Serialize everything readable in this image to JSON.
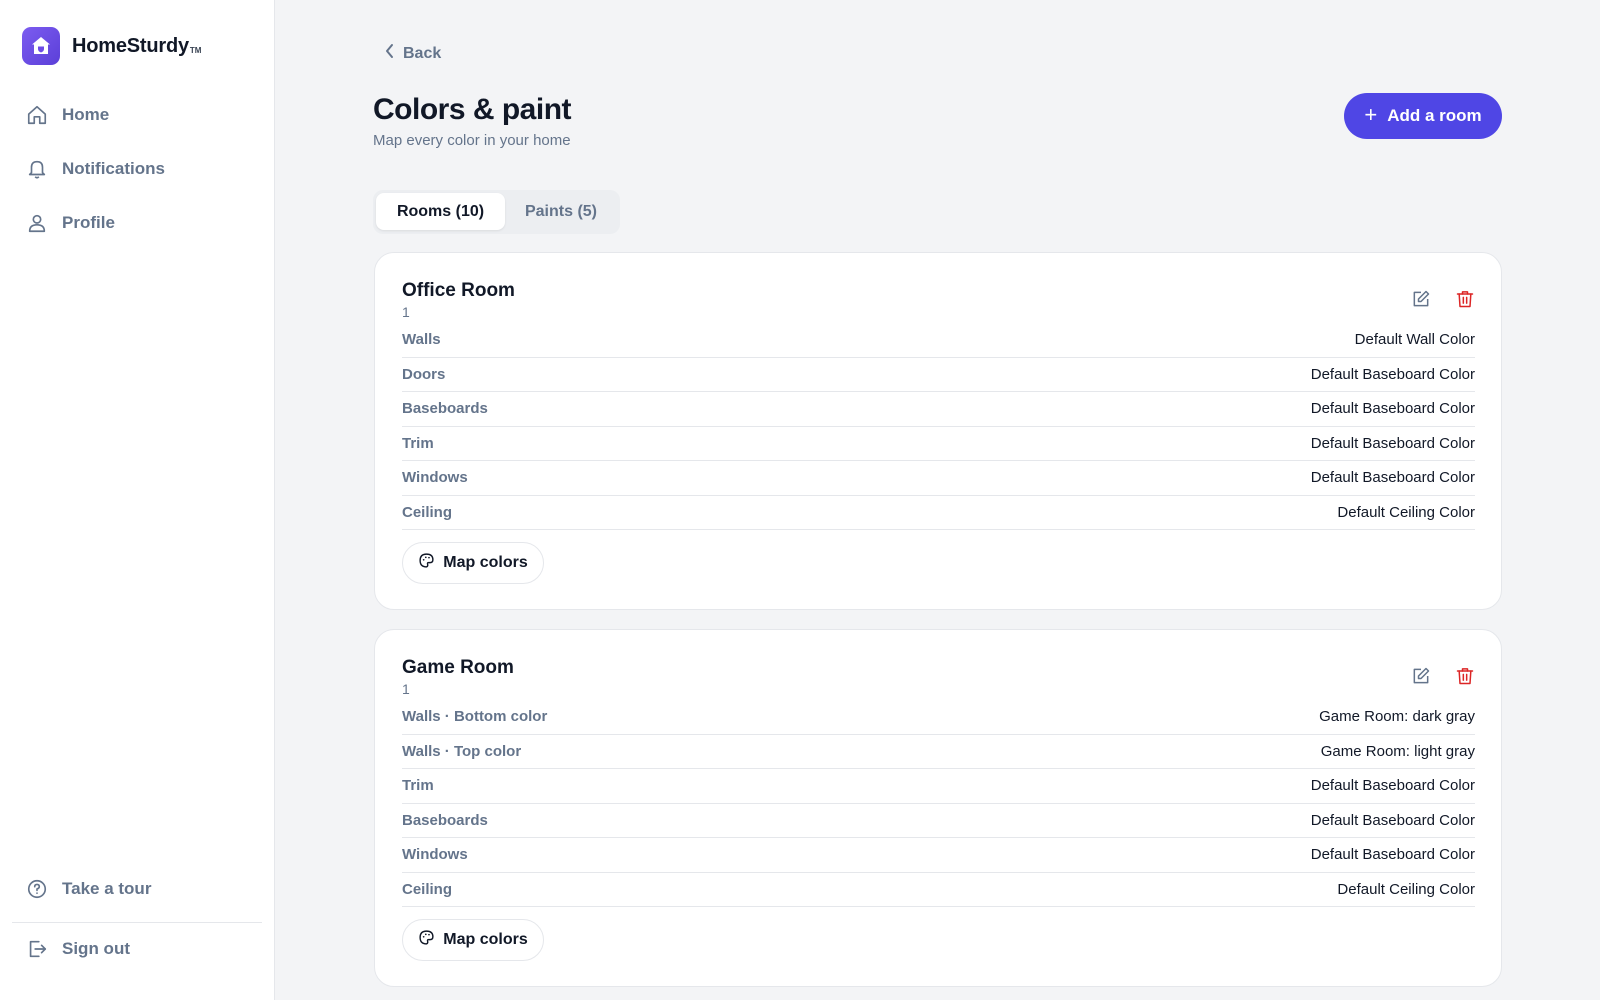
{
  "app": {
    "name": "HomeSturdy",
    "tm": "TM"
  },
  "sidebar": {
    "nav": [
      {
        "label": "Home",
        "icon": "home-icon"
      },
      {
        "label": "Notifications",
        "icon": "bell-icon"
      },
      {
        "label": "Profile",
        "icon": "user-icon"
      }
    ],
    "bottom": [
      {
        "label": "Take a tour",
        "icon": "help-circle-icon"
      },
      {
        "label": "Sign out",
        "icon": "sign-out-icon"
      }
    ]
  },
  "header": {
    "back_label": "Back",
    "title": "Colors & paint",
    "subtitle": "Map every color in your home",
    "add_button_label": "Add a room"
  },
  "tabs": [
    {
      "label": "Rooms (10)",
      "active": true
    },
    {
      "label": "Paints (5)",
      "active": false
    }
  ],
  "rooms": [
    {
      "name": "Office Room",
      "sub": "1",
      "rows": [
        {
          "label": "Walls",
          "value": "Default Wall Color"
        },
        {
          "label": "Doors",
          "value": "Default Baseboard Color"
        },
        {
          "label": "Baseboards",
          "value": "Default Baseboard Color"
        },
        {
          "label": "Trim",
          "value": "Default Baseboard Color"
        },
        {
          "label": "Windows",
          "value": "Default Baseboard Color"
        },
        {
          "label": "Ceiling",
          "value": "Default Ceiling Color"
        }
      ],
      "map_button_label": "Map colors"
    },
    {
      "name": "Game Room",
      "sub": "1",
      "rows": [
        {
          "label": "Walls · Bottom color",
          "value": "Game Room: dark gray"
        },
        {
          "label": "Walls · Top color",
          "value": "Game Room: light gray"
        },
        {
          "label": "Trim",
          "value": "Default Baseboard Color"
        },
        {
          "label": "Baseboards",
          "value": "Default Baseboard Color"
        },
        {
          "label": "Windows",
          "value": "Default Baseboard Color"
        },
        {
          "label": "Ceiling",
          "value": "Default Ceiling Color"
        }
      ],
      "map_button_label": "Map colors"
    }
  ],
  "colors": {
    "accent": "#4f46e5",
    "logo": "#6d4be6",
    "danger": "#dc2626",
    "muted_text": "#64748b"
  }
}
